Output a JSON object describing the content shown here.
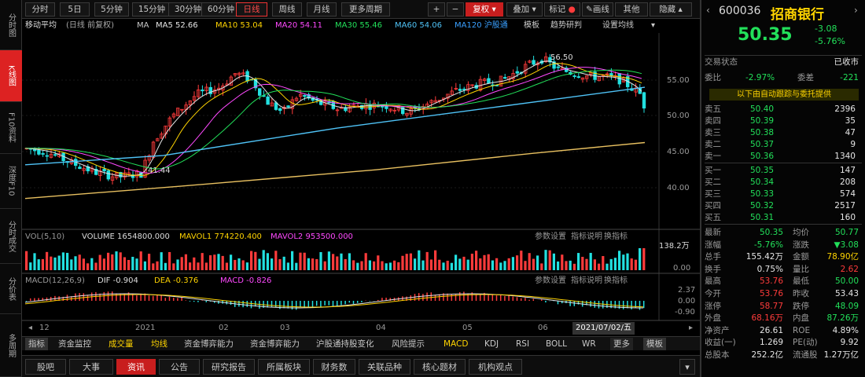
{
  "left_nav": [
    {
      "label": "分时图",
      "active": false
    },
    {
      "label": "K线图",
      "active": true
    },
    {
      "label": "F10资料",
      "active": false
    },
    {
      "label": "深度F10",
      "active": false
    },
    {
      "label": "分时成交",
      "active": false
    },
    {
      "label": "分价表",
      "active": false
    },
    {
      "label": "多周期",
      "active": false
    }
  ],
  "toolbar": {
    "periods": [
      "分时",
      "5日",
      "5分钟",
      "15分钟",
      "30分钟",
      "60分钟",
      "日线",
      "周线",
      "月线",
      "更多周期"
    ],
    "selected_period": "日线",
    "plus": "+",
    "minus": "−",
    "adjust": "复权",
    "overlay": "叠加",
    "marks": "标记",
    "draw": "画线",
    "more": "其他",
    "hide": "隐藏"
  },
  "ma_line": {
    "name": "移动平均",
    "mode": "(日线 前复权)",
    "items": [
      {
        "label": "MA",
        "color": "#c8c8c8"
      },
      {
        "label": "MA5 52.66",
        "color": "#e6e6e6"
      },
      {
        "label": "MA10 53.04",
        "color": "#ffd400"
      },
      {
        "label": "MA20 54.11",
        "color": "#ff49ff"
      },
      {
        "label": "MA30 55.46",
        "color": "#22e05a"
      },
      {
        "label": "MA60 54.06",
        "color": "#4fc3f7"
      },
      {
        "label": "MA120 沪股通",
        "color": "#3aa0ff"
      }
    ],
    "right_links": [
      "模板",
      "趋势研判",
      "设置均线"
    ]
  },
  "price_axis": [
    "55.00",
    "50.00",
    "45.00",
    "40.00"
  ],
  "annotations": {
    "low": "41.44",
    "high": "56.50"
  },
  "volume_line": {
    "title": "VOL(5,10)",
    "vol": "VOLUME 1654800.000",
    "mavol1": "MAVOL1 774220.400",
    "mavol2": "MAVOL2 953500.000",
    "links": [
      "参数设置",
      "指标说明",
      "换指标"
    ],
    "axis_top": "138.2万",
    "axis_zero": "0.00"
  },
  "macd_line": {
    "title": "MACD(12,26,9)",
    "dif": "DIF -0.904",
    "dea": "DEA -0.376",
    "macd": "MACD -0.826",
    "axis": [
      "2.37",
      "0.00",
      "-0.90"
    ],
    "links": [
      "参数设置",
      "指标说明",
      "换指标"
    ]
  },
  "date_axis": [
    "12",
    "2021",
    "02",
    "03",
    "04",
    "05",
    "06",
    "2021/07/02/五"
  ],
  "indicator_tabs": [
    "指标",
    "资金监控",
    "成交量",
    "均线",
    "资金博弈能力",
    "资金博弈能力",
    "沪股通持股变化",
    "风险提示",
    "MACD",
    "KDJ",
    "RSI",
    "BOLL",
    "WR",
    "更多",
    "模板"
  ],
  "bottom_tabs": [
    "股吧",
    "大事",
    "资讯",
    "公告",
    "研究报告",
    "所属板块",
    "财务数",
    "关联品种",
    "核心题材",
    "机构观点"
  ],
  "bottom_tabs_selected": "资讯",
  "quote": {
    "code": "600036",
    "name": "招商银行",
    "price": "50.35",
    "change": "-3.08",
    "change_pct": "-5.76%",
    "status_label": "交易状态",
    "status": "已收市",
    "weibi_label": "委比",
    "weibi": "-2.97%",
    "weicha_label": "委差",
    "weicha": "-221",
    "banner": "以下由自动跟踪与委托提供",
    "asks": [
      {
        "label": "卖五",
        "price": "50.40",
        "vol": "2396"
      },
      {
        "label": "卖四",
        "price": "50.39",
        "vol": "35"
      },
      {
        "label": "卖三",
        "price": "50.38",
        "vol": "47"
      },
      {
        "label": "卖二",
        "price": "50.37",
        "vol": "9"
      },
      {
        "label": "卖一",
        "price": "50.36",
        "vol": "1340"
      }
    ],
    "bids": [
      {
        "label": "买一",
        "price": "50.35",
        "vol": "147"
      },
      {
        "label": "买二",
        "price": "50.34",
        "vol": "208"
      },
      {
        "label": "买三",
        "price": "50.33",
        "vol": "574"
      },
      {
        "label": "买四",
        "price": "50.32",
        "vol": "2517"
      },
      {
        "label": "买五",
        "price": "50.31",
        "vol": "160"
      }
    ],
    "stats": [
      {
        "l1": "最新",
        "v1": "50.35",
        "c1": "green",
        "l2": "均价",
        "v2": "50.77",
        "c2": "green"
      },
      {
        "l1": "涨幅",
        "v1": "-5.76%",
        "c1": "green",
        "l2": "涨跌",
        "v2": "▼3.08",
        "c2": "green"
      },
      {
        "l1": "总手",
        "v1": "155.42万",
        "c1": "white",
        "l2": "金额",
        "v2": "78.90亿",
        "c2": "yellow"
      },
      {
        "l1": "换手",
        "v1": "0.75%",
        "c1": "white",
        "l2": "量比",
        "v2": "2.62",
        "c2": "red"
      },
      {
        "l1": "最高",
        "v1": "53.76",
        "c1": "red",
        "l2": "最低",
        "v2": "50.00",
        "c2": "green"
      },
      {
        "l1": "今开",
        "v1": "53.76",
        "c1": "red",
        "l2": "昨收",
        "v2": "53.43",
        "c2": "white"
      },
      {
        "l1": "涨停",
        "v1": "58.77",
        "c1": "red",
        "l2": "跌停",
        "v2": "48.09",
        "c2": "green"
      },
      {
        "l1": "外盘",
        "v1": "68.16万",
        "c1": "red",
        "l2": "内盘",
        "v2": "87.26万",
        "c2": "green"
      },
      {
        "l1": "净资产",
        "v1": "26.61",
        "c1": "white",
        "l2": "ROE",
        "v2": "4.89%",
        "c2": "white"
      },
      {
        "l1": "收益(一)",
        "v1": "1.269",
        "c1": "white",
        "l2": "PE(动)",
        "v2": "9.92",
        "c2": "white"
      },
      {
        "l1": "总股本",
        "v1": "252.2亿",
        "c1": "white",
        "l2": "流通股",
        "v2": "1.27万亿",
        "c2": "white"
      }
    ]
  },
  "colors": {
    "up": "#ff3b3b",
    "down": "#22e0e0",
    "ma5": "#e6e6e6",
    "ma10": "#ffd400",
    "ma20": "#ff49ff",
    "ma30": "#22e05a",
    "ma60": "#4fc3f7",
    "ma120": "#e8c060"
  }
}
